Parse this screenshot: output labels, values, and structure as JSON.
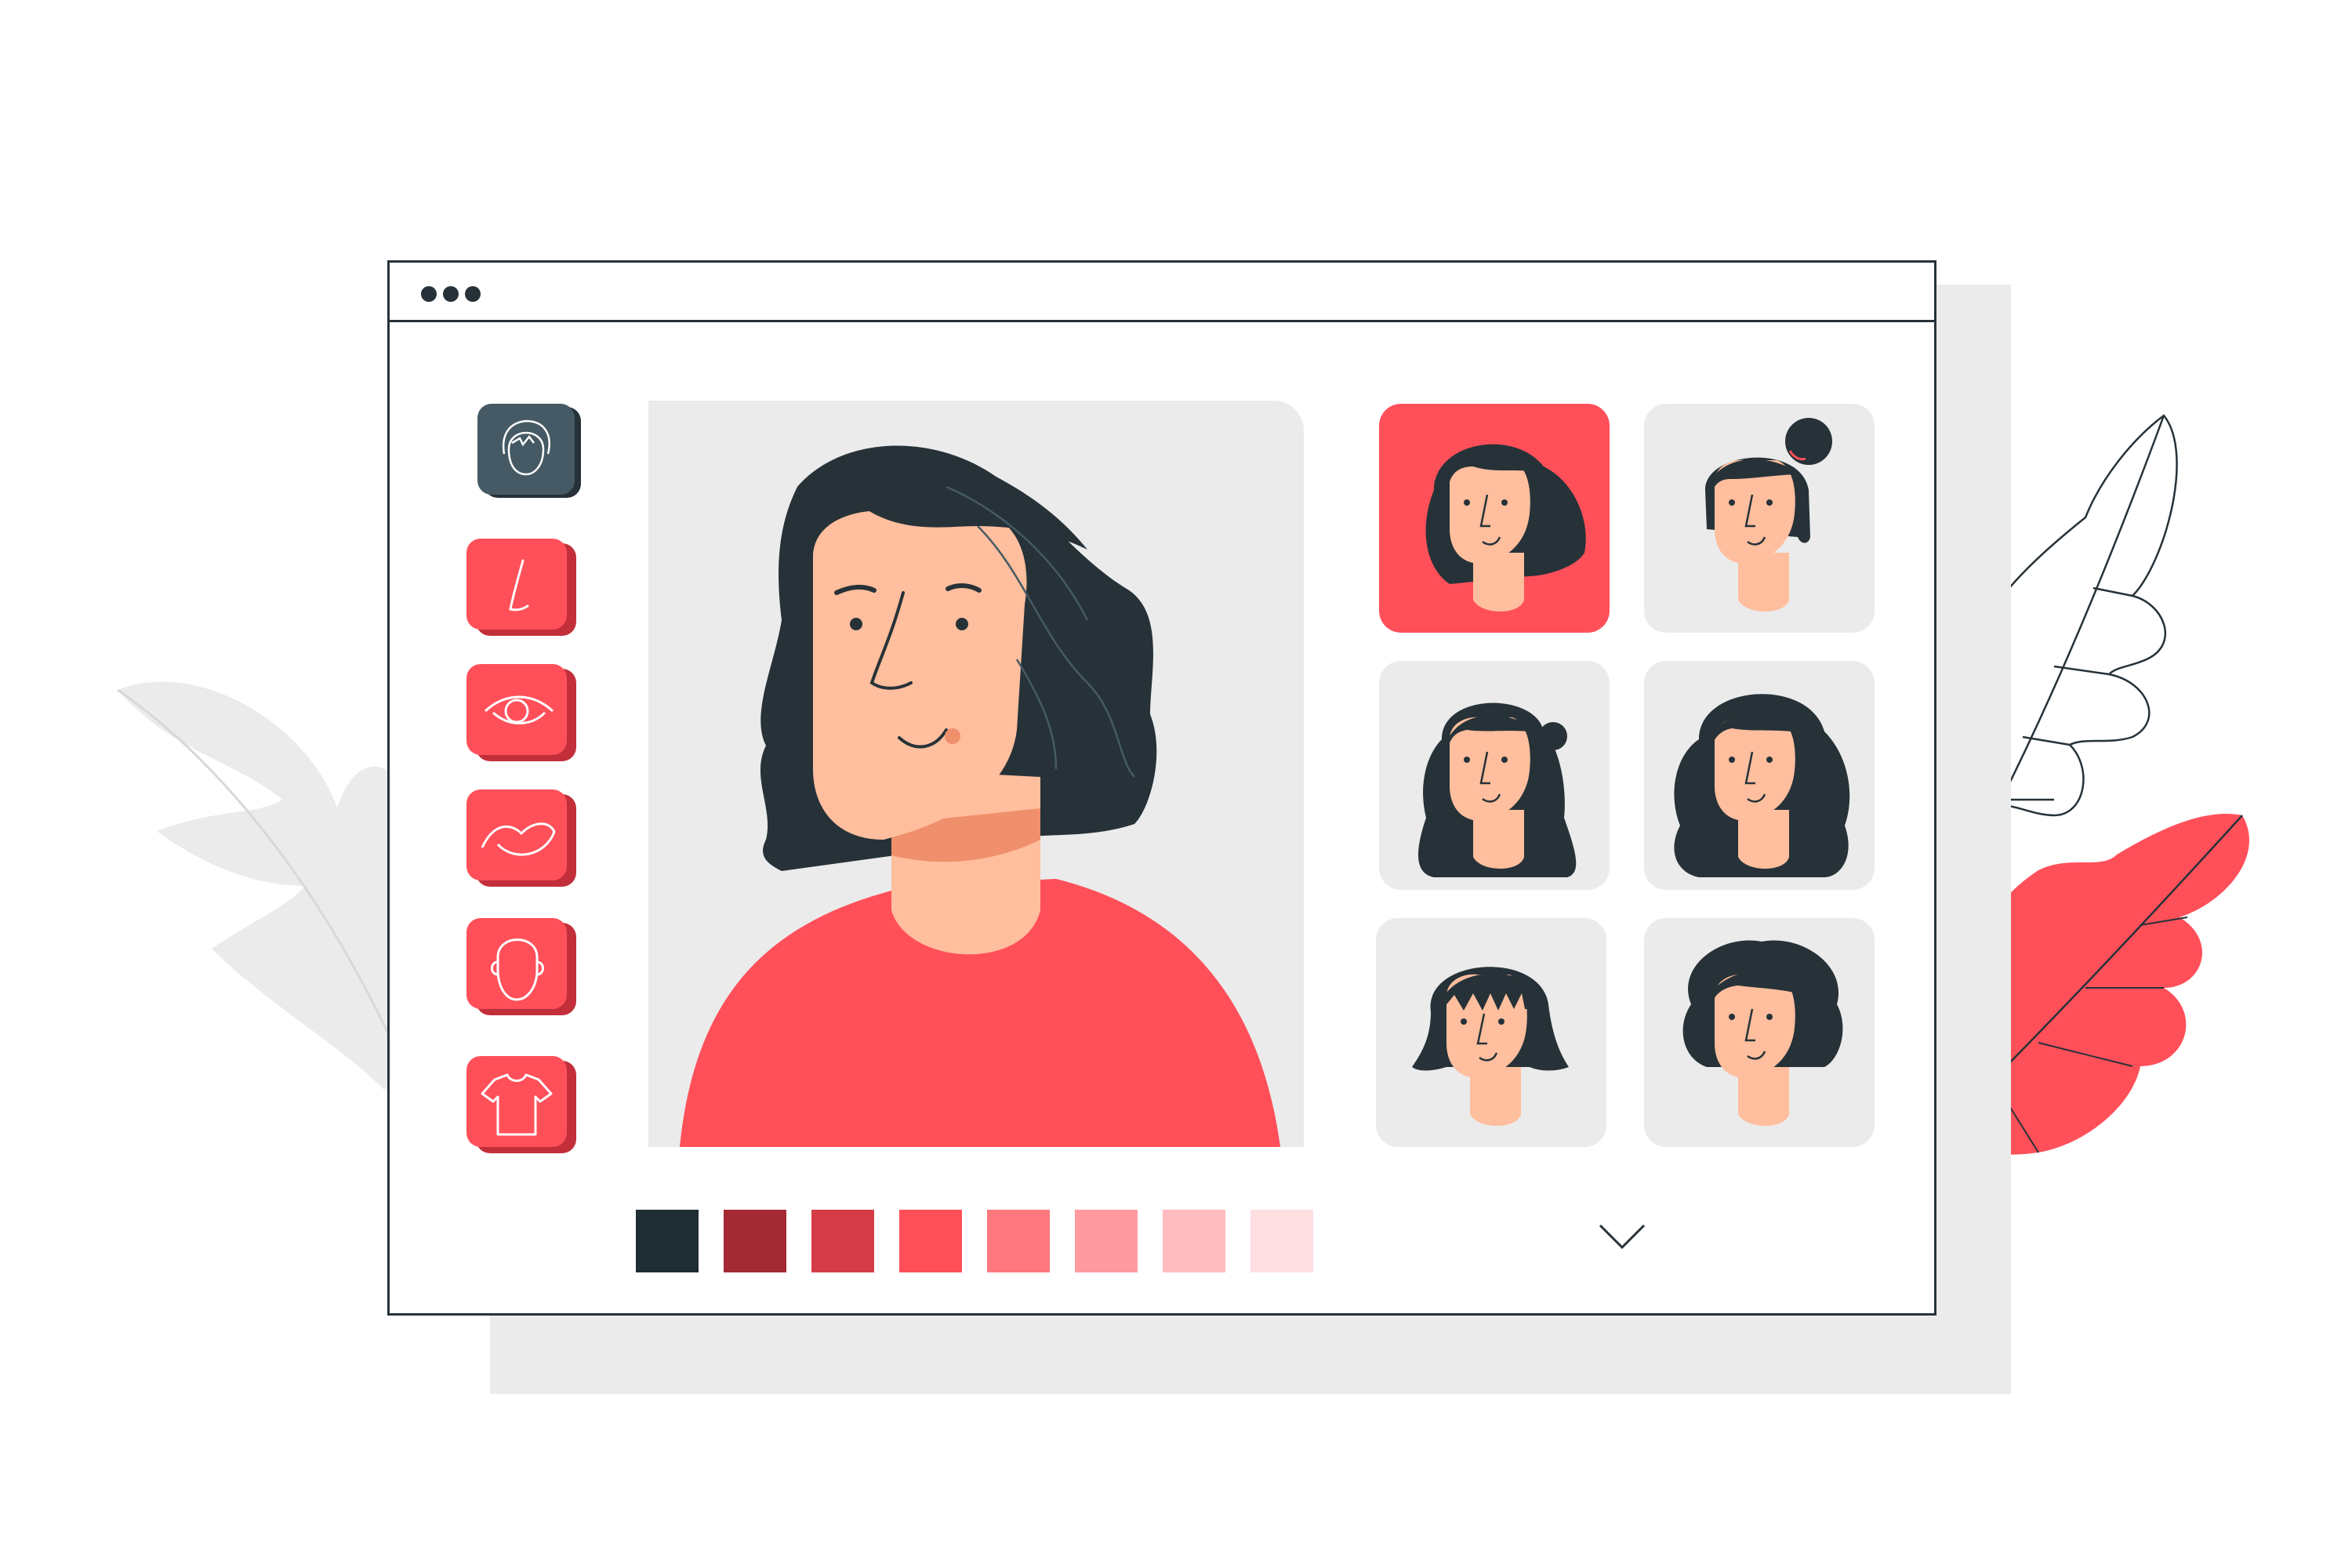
{
  "colors": {
    "accent": "#ff505a",
    "dark": "#263238",
    "skin": "#ffbe9d",
    "panel": "#ebebeb"
  },
  "window": {
    "title_dots": [
      "dot",
      "dot",
      "dot"
    ]
  },
  "toolbar": {
    "tools": [
      {
        "name": "hair-tool",
        "icon": "hair-icon",
        "active": true
      },
      {
        "name": "nose-tool",
        "icon": "nose-icon",
        "active": false
      },
      {
        "name": "eye-tool",
        "icon": "eye-icon",
        "active": false
      },
      {
        "name": "mouth-tool",
        "icon": "mouth-icon",
        "active": false
      },
      {
        "name": "face-shape-tool",
        "icon": "face-shape-icon",
        "active": false
      },
      {
        "name": "clothing-tool",
        "icon": "tshirt-icon",
        "active": false
      }
    ]
  },
  "hairstyle_options": [
    {
      "name": "wavy-bob",
      "selected": true
    },
    {
      "name": "top-bun",
      "selected": false
    },
    {
      "name": "half-up-waves",
      "selected": false
    },
    {
      "name": "long-curls",
      "selected": false
    },
    {
      "name": "bob-with-bangs",
      "selected": false
    },
    {
      "name": "short-curly",
      "selected": false
    }
  ],
  "palette": [
    "#1f2d34",
    "#a32a33",
    "#d43d47",
    "#ff505a",
    "#ff7880",
    "#ff9aa1",
    "#ffbcc0",
    "#ffdfe1"
  ],
  "dropdown_icon": "chevron-down-icon"
}
